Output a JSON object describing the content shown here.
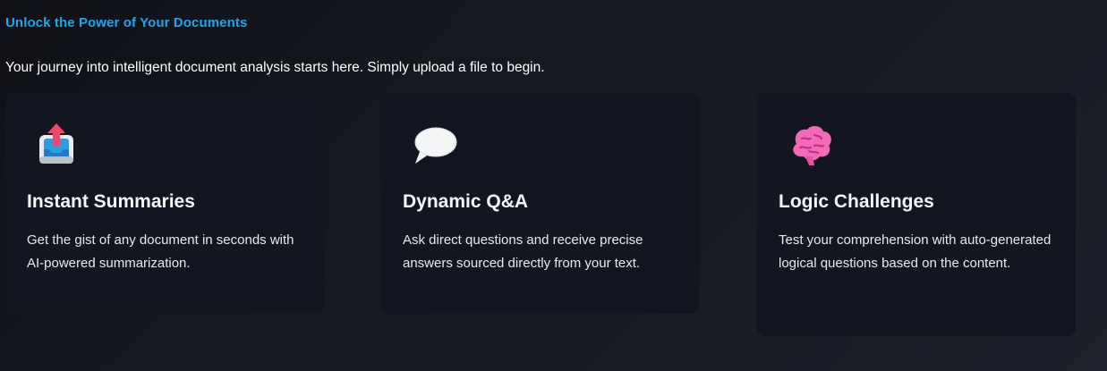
{
  "header": {
    "headline": "Unlock the Power of Your Documents",
    "intro": "Your journey into intelligent document analysis starts here. Simply upload a file to begin."
  },
  "colors": {
    "accent": "#1aa7ee",
    "card_background": "#131620",
    "page_background": "#161a22"
  },
  "features": [
    {
      "icon": "inbox-upload-icon",
      "title": "Instant Summaries",
      "description": "Get the gist of any document in seconds with AI-powered summarization."
    },
    {
      "icon": "speech-bubble-icon",
      "title": "Dynamic Q&A",
      "description": "Ask direct questions and receive precise answers sourced directly from your text."
    },
    {
      "icon": "brain-icon",
      "title": "Logic Challenges",
      "description": "Test your comprehension with auto-generated logical questions based on the content."
    }
  ]
}
